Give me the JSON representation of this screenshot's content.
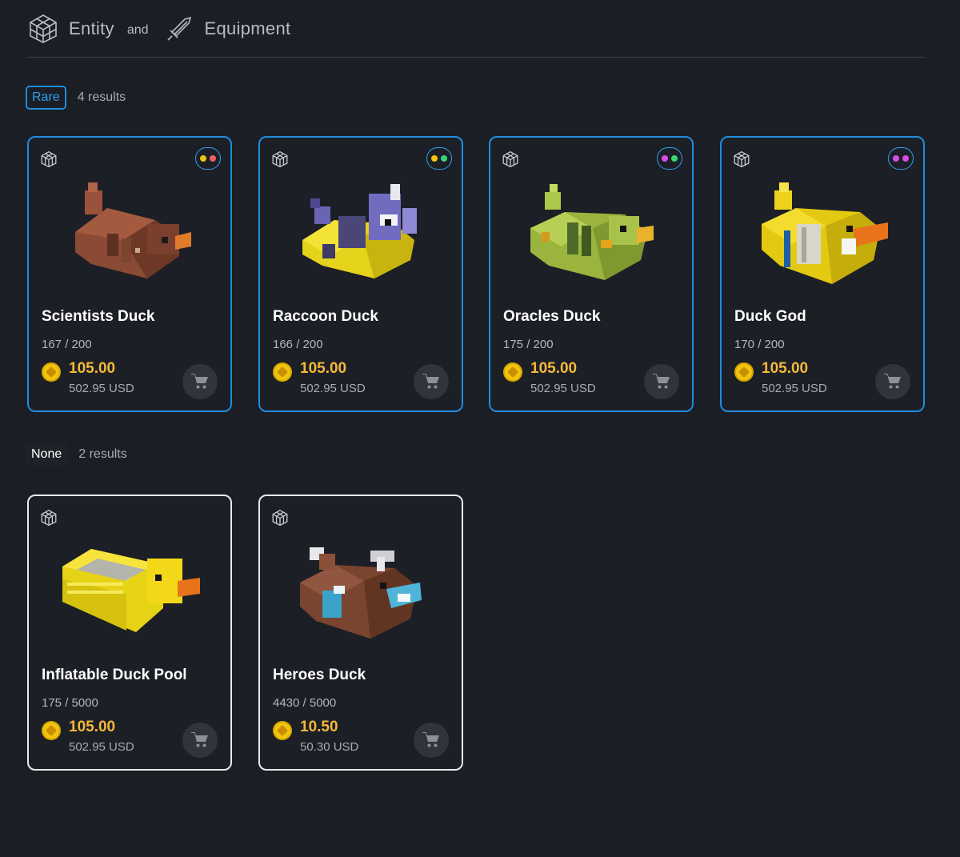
{
  "header": {
    "entity_label": "Entity",
    "and_label": "and",
    "equipment_label": "Equipment"
  },
  "sections": [
    {
      "badge": "Rare",
      "count": "4 results",
      "items": [
        {
          "name": "Scientists Duck",
          "supply": "167 / 200",
          "price": "105.00",
          "usd": "502.95 USD",
          "dots": [
            "#f1c40f",
            "#f06262"
          ]
        },
        {
          "name": "Raccoon Duck",
          "supply": "166 / 200",
          "price": "105.00",
          "usd": "502.95 USD",
          "dots": [
            "#f1c40f",
            "#37d67a"
          ]
        },
        {
          "name": "Oracles Duck",
          "supply": "175 / 200",
          "price": "105.00",
          "usd": "502.95 USD",
          "dots": [
            "#d64ee8",
            "#37d67a"
          ]
        },
        {
          "name": "Duck God",
          "supply": "170 / 200",
          "price": "105.00",
          "usd": "502.95 USD",
          "dots": [
            "#d64ee8",
            "#d64ee8"
          ]
        }
      ]
    },
    {
      "badge": "None",
      "count": "2 results",
      "items": [
        {
          "name": "Inflatable Duck Pool",
          "supply": "175 / 5000",
          "price": "105.00",
          "usd": "502.95 USD"
        },
        {
          "name": "Heroes Duck",
          "supply": "4430 / 5000",
          "price": "10.50",
          "usd": "50.30 USD"
        }
      ]
    }
  ],
  "colors": {
    "background": "#1b1e24",
    "rare_accent": "#1f8ce0",
    "price": "#f6b83a",
    "coin": "#f1c40f"
  },
  "icons": {
    "entity": "cube-wireframe-icon",
    "equipment": "sword-icon",
    "cart": "shopping-cart-icon"
  }
}
